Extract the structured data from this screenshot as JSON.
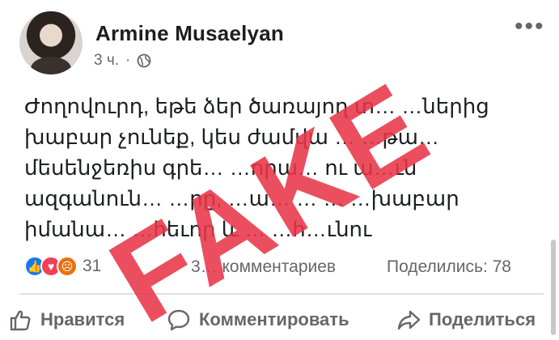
{
  "post": {
    "author": "Armine Musaelyan",
    "time": "3 ч.",
    "separator": "·",
    "privacy_icon": "globe-icon",
    "more_icon": "more-options-icon",
    "text_lines": [
      "Ժողովուրդ, եթե ձեր ծառայող տ…   …ներից",
      "խաբար չունեք, կես ժամվա … …թա…",
      "մեսենջեռիս գրե…  …որա…       ու ա…ւն",
      "ազգանուն… …րը, …ա…  …  …  …խաբար",
      "իմանա… …հեւոր և … …հ…ւնու"
    ]
  },
  "reactions": {
    "icons": [
      "like-icon",
      "love-icon",
      "angry-icon"
    ],
    "count": "31",
    "comments": "3… комментариев",
    "shares": "Поделились: 78"
  },
  "actions": {
    "like": "Нравится",
    "comment": "Комментировать",
    "share": "Поделиться"
  },
  "overlay": {
    "stamp": "FAKE"
  },
  "colors": {
    "stamp": "#e83648",
    "like": "#1877f2",
    "love": "#f33e58",
    "angry": "#e9710f",
    "secondary_text": "#65676b"
  }
}
